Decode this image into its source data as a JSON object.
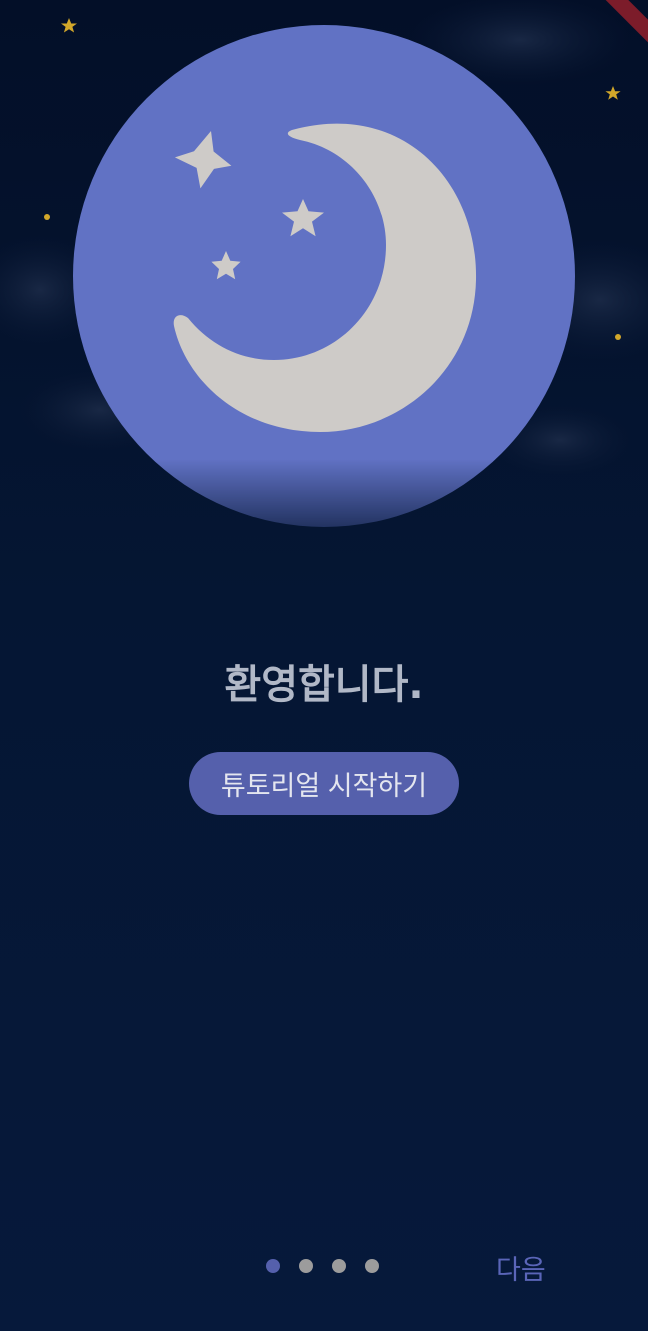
{
  "welcome": {
    "title": "환영합니다.",
    "start_button": "튜토리얼 시작하기"
  },
  "pager": {
    "total": 4,
    "current": 1
  },
  "footer": {
    "next_label": "다음"
  },
  "colors": {
    "background": "#061533",
    "moon_disc": "#6172c4",
    "moon": "#cecbc8",
    "accent": "#5560ac",
    "star": "#d2a72a"
  }
}
